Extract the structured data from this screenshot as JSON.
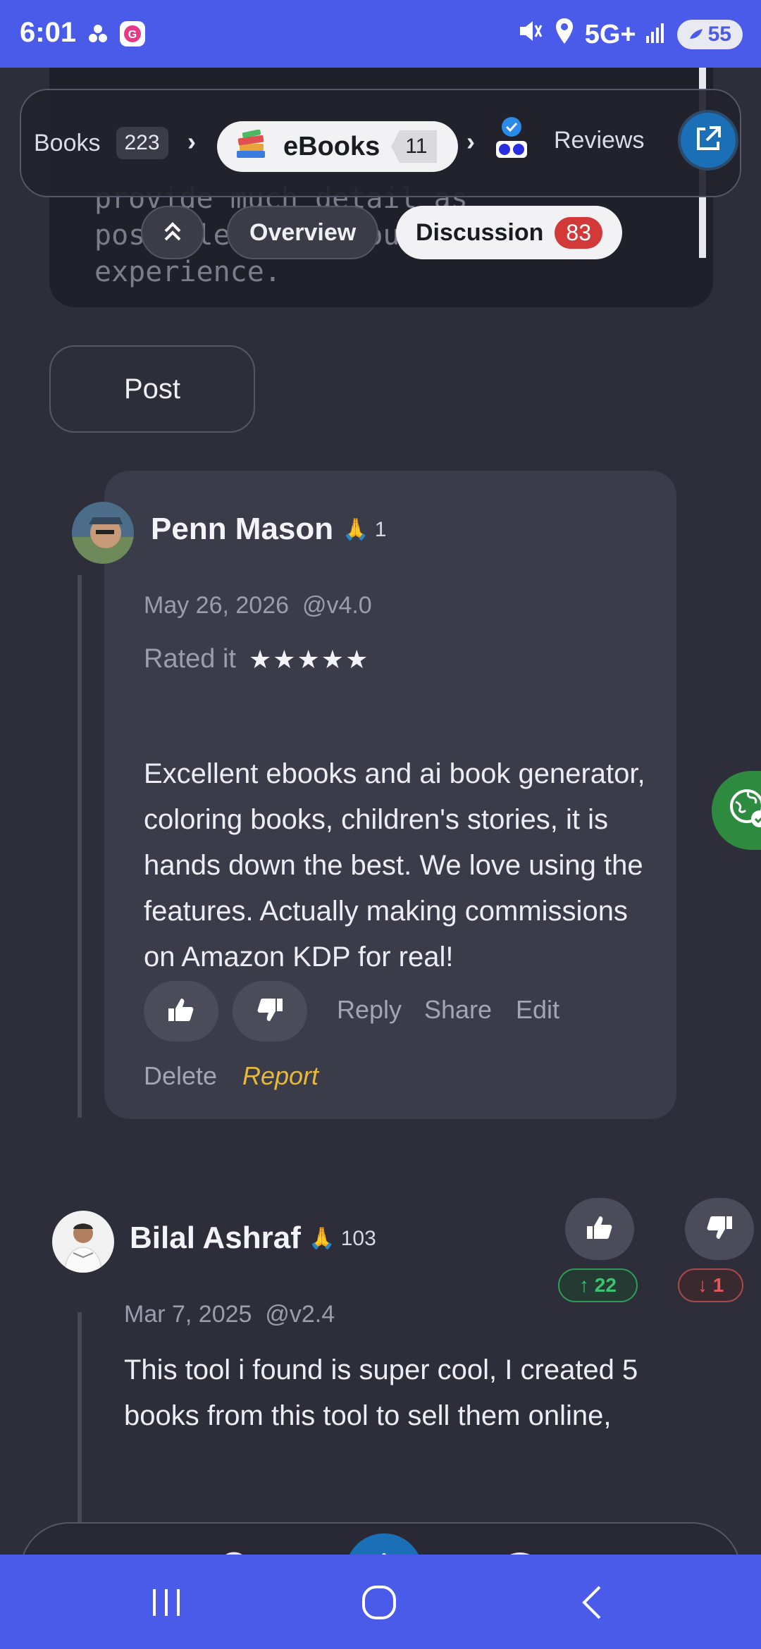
{
  "status_bar": {
    "time": "6:01",
    "network": "5G+",
    "battery": "55",
    "icons": [
      "dots-icon",
      "g-app-icon",
      "mute-icon",
      "location-icon",
      "signal-icon",
      "battery-icon"
    ]
  },
  "editor": {
    "visible_text": "provide much detail as\npossible about your\nexperience."
  },
  "breadcrumb": {
    "books_label": "Books",
    "books_count": "223",
    "ebooks_label": "eBooks",
    "ebooks_count": "11",
    "reviews_label": "Reviews"
  },
  "tabs": {
    "overview": "Overview",
    "discussion": "Discussion",
    "discussion_count": "83"
  },
  "post_button": "Post",
  "comments": [
    {
      "author": "Penn Mason",
      "karma": "1",
      "date": "May 26, 2026",
      "version": "@v4.0",
      "rated_label": "Rated it",
      "stars": "★★★★★",
      "rating": 5,
      "text": "Excellent ebooks and ai book generator, coloring books, children's stories, it is hands down the best. We love using the features. Actually making commissions on Amazon KDP for real!",
      "actions": {
        "reply": "Reply",
        "share": "Share",
        "edit": "Edit",
        "delete": "Delete",
        "report": "Report"
      }
    },
    {
      "author": "Bilal Ashraf",
      "karma": "103",
      "date": "Mar 7, 2025",
      "version": "@v2.4",
      "upvotes": "↑ 22",
      "downvotes": "↓ 1",
      "text": "This tool i found is super cool, I created 5 books from this tool to sell them online,"
    }
  ],
  "colors": {
    "system_bar": "#4a5bea",
    "background": "#2d2e3a",
    "card": "#3b3c4a",
    "accent_blue": "#1a6fb7",
    "badge_red": "#d23a3a",
    "report": "#e6b83c",
    "upvote": "#3cc46f",
    "downvote": "#e05a5a"
  }
}
